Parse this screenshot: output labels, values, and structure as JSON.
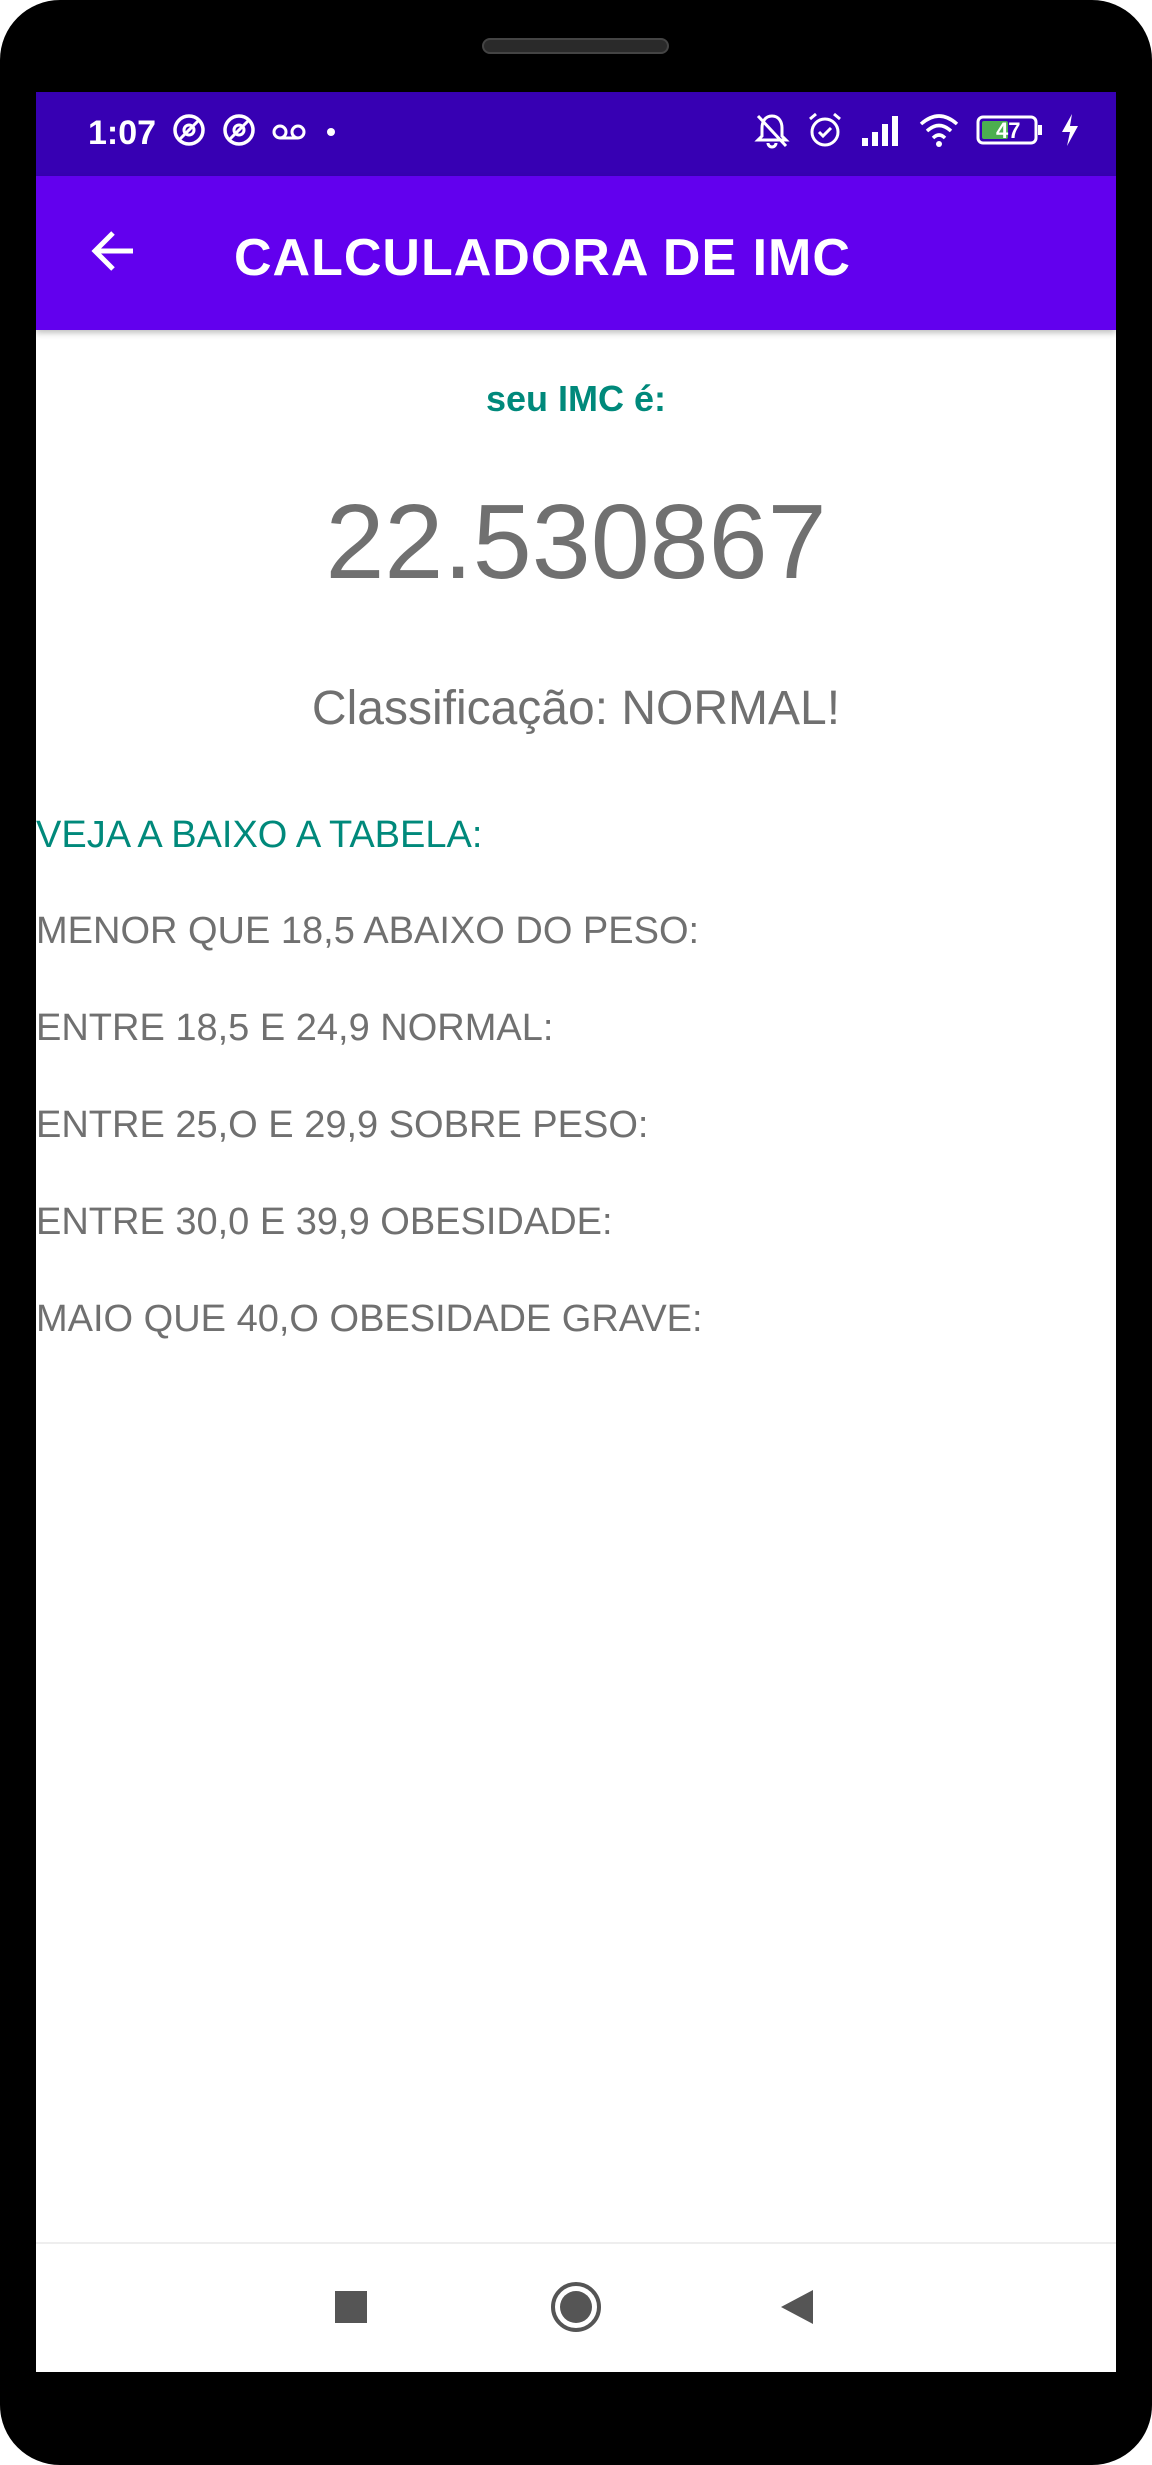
{
  "status_bar": {
    "time": "1:07",
    "left_icons": [
      "at-sign-icon",
      "at-sign-icon",
      "voicemail-icon",
      "dot-icon"
    ],
    "right_icons": [
      "muted-bell-icon",
      "alarm-icon",
      "signal-icon",
      "wifi-icon",
      "battery-icon",
      "charging-icon"
    ],
    "battery_level": "47"
  },
  "app_bar": {
    "title": "CALCULADORA DE IMC",
    "back_icon": "arrow-left-icon"
  },
  "result": {
    "label": "seu IMC é:",
    "value": "22.530867",
    "classification": "Classificação: NORMAL!"
  },
  "table": {
    "heading": "VEJA A BAIXO A TABELA:",
    "rows": [
      "MENOR QUE 18,5 ABAIXO DO PESO:",
      "ENTRE 18,5 E 24,9 NORMAL:",
      "ENTRE 25,O E 29,9 SOBRE PESO:",
      "ENTRE 30,0 E 39,9 OBESIDADE:",
      "MAIO QUE 40,O OBESIDADE GRAVE:"
    ]
  },
  "nav_bar": {
    "icons": [
      "recents-square-icon",
      "home-circle-icon",
      "back-triangle-icon"
    ]
  },
  "colors": {
    "status_bar": "#3700b3",
    "app_bar": "#6200ee",
    "accent_teal": "#00897b",
    "body_text": "#707070"
  }
}
